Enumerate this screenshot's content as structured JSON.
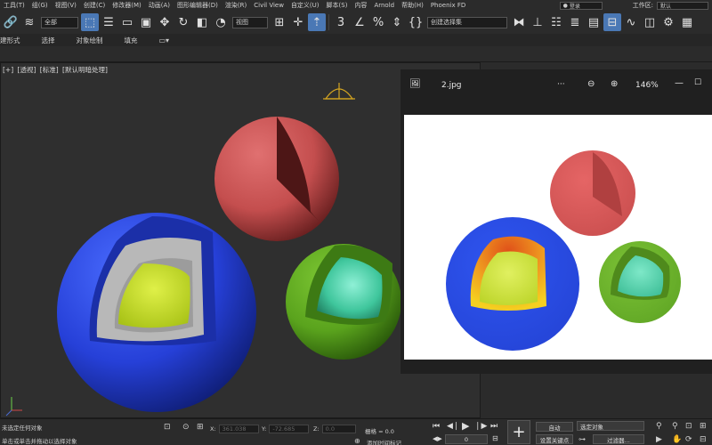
{
  "menubar": {
    "items": [
      "工具(T)",
      "组(G)",
      "视图(V)",
      "创建(C)",
      "修改器(M)",
      "动画(A)",
      "图形编辑器(D)",
      "渲染(R)",
      "Civil View",
      "自定义(U)",
      "脚本(S)",
      "内容",
      "Arnold",
      "帮助(H)",
      "Phoenix FD"
    ],
    "user": "登录",
    "workspace_label": "工作区:",
    "workspace_value": "默认"
  },
  "toolbar": {
    "scope_select": "全部",
    "view_select": "视图",
    "selection_set": "创建选择集"
  },
  "ribbon": {
    "items": [
      "建形式",
      "选择",
      "对象绘制",
      "填充"
    ]
  },
  "viewport": {
    "label_plus": "[+]",
    "label_view": "[透视]",
    "label_shading": "[标准]",
    "label_lighting": "[默认明暗处理]"
  },
  "viewer": {
    "filename": "2.jpg",
    "more": "···",
    "zoom": "146%"
  },
  "status": {
    "line1": "未选定任何对象",
    "line2": "单击或单击并拖动以选择对象",
    "x_label": "X:",
    "x_value": "361.038",
    "y_label": "Y:",
    "y_value": "-72.685",
    "z_label": "Z:",
    "z_value": "0.0",
    "grid": "栅格 = 0.0",
    "add_time_tag": "添加时间标记",
    "frame": "0",
    "auto": "自动",
    "set_key": "设置关键点",
    "selected_object": "选定对象",
    "filter": "过滤器..."
  },
  "colors": {
    "blue_sphere": "#2a47e6",
    "red_sphere": "#cc5555",
    "green_sphere": "#5da81e",
    "yellow_core": "#c7e21f",
    "teal_core": "#3fc69c",
    "active_blue": "#4a78b5"
  }
}
